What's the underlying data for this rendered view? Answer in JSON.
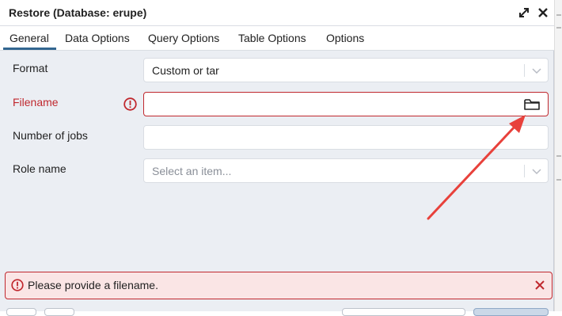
{
  "dialog": {
    "title": "Restore (Database: erupe)"
  },
  "tabs": [
    {
      "label": "General"
    },
    {
      "label": "Data Options"
    },
    {
      "label": "Query Options"
    },
    {
      "label": "Table Options"
    },
    {
      "label": "Options"
    }
  ],
  "form": {
    "format": {
      "label": "Format",
      "value": "Custom or tar"
    },
    "filename": {
      "label": "Filename",
      "value": ""
    },
    "jobs": {
      "label": "Number of jobs",
      "value": ""
    },
    "role": {
      "label": "Role name",
      "placeholder": "Select an item..."
    }
  },
  "alert": {
    "message": "Please provide a filename."
  },
  "colors": {
    "error": "#c0282e",
    "accent": "#326690",
    "annotation": "#e8413b"
  }
}
